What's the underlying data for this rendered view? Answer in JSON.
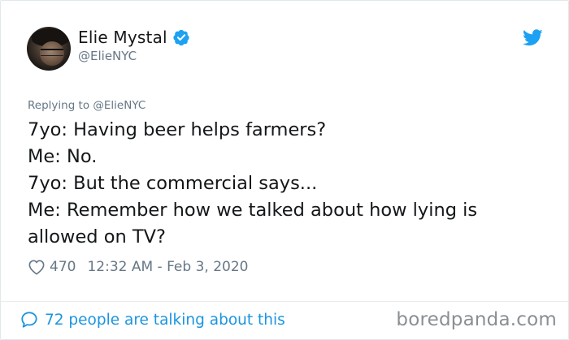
{
  "user": {
    "name": "Elie Mystal",
    "handle": "@ElieNYC",
    "verified_icon": "verified-badge-icon",
    "avatar": "profile-photo"
  },
  "tweet": {
    "replying_to": "Replying to @ElieNYC",
    "lines": [
      "7yo: Having beer helps farmers?",
      "Me: No.",
      "7yo: But the commercial says...",
      "Me: Remember how we talked about how lying is",
      "allowed on TV?"
    ],
    "likes": "470",
    "timestamp": "12:32 AM - Feb 3, 2020"
  },
  "footer": {
    "talking": "72 people are talking about this",
    "watermark": "boredpanda.com"
  },
  "colors": {
    "accent": "#1da1f2",
    "link": "#1b95e0",
    "muted": "#657786",
    "text": "#14171a"
  }
}
